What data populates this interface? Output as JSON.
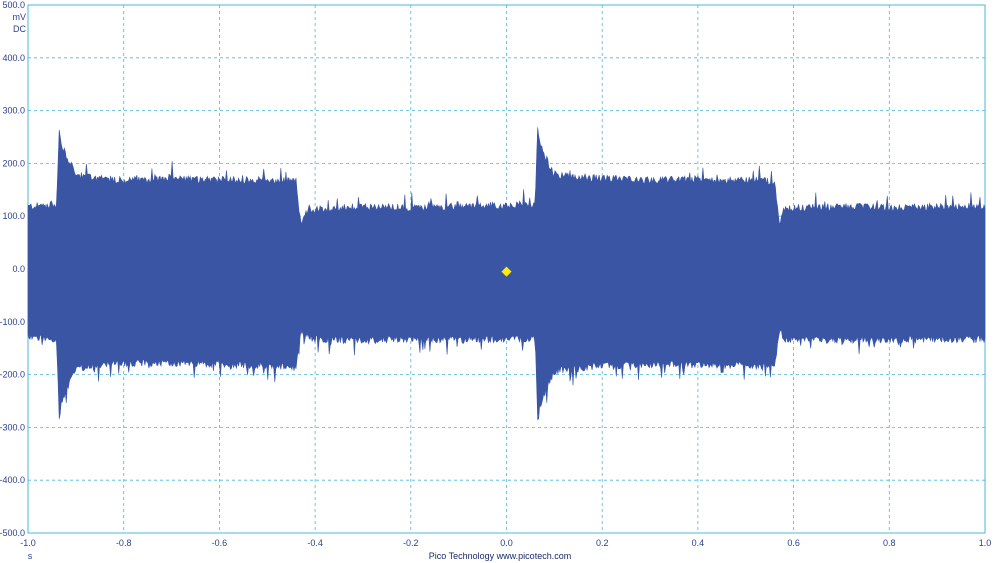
{
  "chart_data": {
    "type": "line",
    "ylabel_unit": "mV",
    "ylabel_coupling": "DC",
    "xlabel_unit": "s",
    "footer_text": "Pico Technology  www.picotech.com",
    "xlim": [
      -1.0,
      1.0
    ],
    "ylim": [
      -500.0,
      500.0
    ],
    "grid": true,
    "x_ticks": [
      "-1.0",
      "-0.8",
      "-0.6",
      "-0.4",
      "-0.2",
      "0.0",
      "0.2",
      "0.4",
      "0.6",
      "0.8",
      "1.0"
    ],
    "y_ticks": [
      "500.0",
      "400.0",
      "300.0",
      "200.0",
      "100.0",
      "0.0",
      "-100.0",
      "-200.0",
      "-300.0",
      "-400.0",
      "-500.0"
    ],
    "trace_color": "#3a55a4",
    "trigger_marker": {
      "x": 0.0,
      "y": -5.0,
      "color": "#ffee00"
    },
    "series": [
      {
        "x": [
          -1.0,
          -0.94,
          -0.935,
          -0.93,
          -0.9,
          -0.85,
          -0.8,
          -0.7,
          -0.6,
          -0.5,
          -0.44,
          -0.43,
          -0.42,
          -0.4,
          -0.3,
          -0.2,
          -0.1,
          0.0,
          0.06,
          0.065,
          0.07,
          0.1,
          0.2,
          0.3,
          0.4,
          0.5,
          0.56,
          0.57,
          0.58,
          0.6,
          0.7,
          0.8,
          0.9,
          1.0
        ],
        "upper": [
          115,
          120,
          260,
          230,
          175,
          168,
          165,
          168,
          166,
          165,
          163,
          80,
          105,
          110,
          115,
          113,
          115,
          118,
          120,
          260,
          230,
          175,
          168,
          165,
          167,
          165,
          163,
          85,
          110,
          113,
          115,
          113,
          115,
          115
        ],
        "lower": [
          -125,
          -130,
          -280,
          -250,
          -185,
          -178,
          -175,
          -175,
          -178,
          -180,
          -185,
          -110,
          -125,
          -130,
          -132,
          -130,
          -130,
          -130,
          -130,
          -280,
          -255,
          -190,
          -180,
          -178,
          -178,
          -180,
          -185,
          -110,
          -130,
          -130,
          -132,
          -130,
          -130,
          -130
        ]
      }
    ]
  }
}
